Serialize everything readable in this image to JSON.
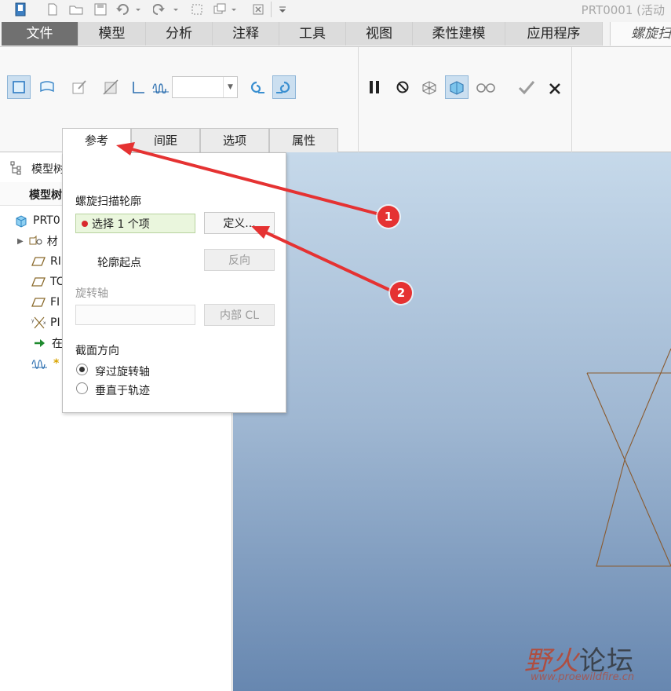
{
  "window": {
    "title": "PRT0001 (活动"
  },
  "ribbon_tabs": [
    {
      "label": "文件"
    },
    {
      "label": "模型"
    },
    {
      "label": "分析"
    },
    {
      "label": "注释"
    },
    {
      "label": "工具"
    },
    {
      "label": "视图"
    },
    {
      "label": "柔性建模"
    },
    {
      "label": "应用程序"
    },
    {
      "label": "螺旋扫"
    }
  ],
  "subtabs": [
    {
      "label": "参考"
    },
    {
      "label": "间距"
    },
    {
      "label": "选项"
    },
    {
      "label": "属性"
    }
  ],
  "tree": {
    "header": "模型树",
    "subheader": "模型树",
    "items": [
      {
        "label": "PRT0",
        "icon": "part-icon"
      },
      {
        "label": "材",
        "icon": "material-icon"
      },
      {
        "label": "RI",
        "icon": "datum-plane-icon"
      },
      {
        "label": "TC",
        "icon": "datum-plane-icon"
      },
      {
        "label": "FI",
        "icon": "datum-plane-icon"
      },
      {
        "label": "PI",
        "icon": "coordinate-system-icon"
      },
      {
        "label": "在",
        "icon": "insert-here-icon"
      },
      {
        "label": "*",
        "icon": "helical-sweep-icon"
      }
    ]
  },
  "panel": {
    "profile_label": "螺旋扫描轮廓",
    "selection_text": "选择 1 个项",
    "define_button": "定义...",
    "start_point_label": "轮廓起点",
    "flip_button": "反向",
    "axis_label": "旋转轴",
    "internal_cl_button": "内部 CL",
    "section_orientation_label": "截面方向",
    "radio_options": [
      {
        "label": "穿过旋转轴",
        "selected": true
      },
      {
        "label": "垂直于轨迹",
        "selected": false
      }
    ]
  },
  "annotations": [
    {
      "number": "1"
    },
    {
      "number": "2"
    }
  ],
  "watermark": {
    "title_red": "野火",
    "title_dark": "论坛",
    "url": "www.proewildfire.cn"
  },
  "colors": {
    "accent_red": "#e53232",
    "file_tab": "#707070",
    "active_tool": "#cbdff0",
    "sketch_line": "#8a5a2e"
  }
}
